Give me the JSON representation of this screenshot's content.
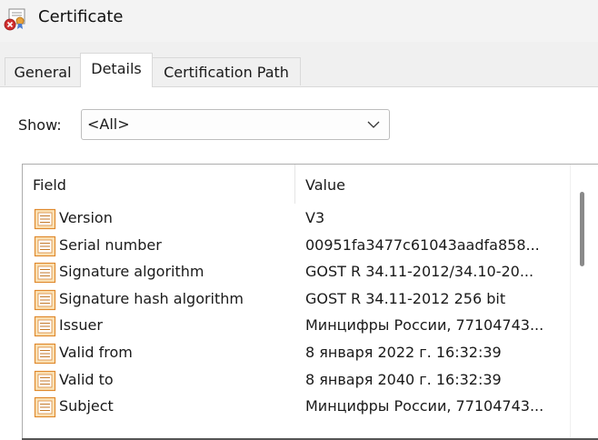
{
  "window": {
    "title": "Certificate",
    "title_icon": "certificate-error-icon"
  },
  "tabs": [
    {
      "label": "General",
      "selected": false
    },
    {
      "label": "Details",
      "selected": true
    },
    {
      "label": "Certification Path",
      "selected": false
    }
  ],
  "show": {
    "label": "Show:",
    "selected": "<All>"
  },
  "list": {
    "headers": {
      "field": "Field",
      "value": "Value"
    },
    "rows": [
      {
        "field": "Version",
        "value": "V3"
      },
      {
        "field": "Serial number",
        "value": "00951fa3477c61043aadfa858..."
      },
      {
        "field": "Signature algorithm",
        "value": "GOST R 34.11-2012/34.10-20..."
      },
      {
        "field": "Signature hash algorithm",
        "value": "GOST R 34.11-2012 256 bit"
      },
      {
        "field": "Issuer",
        "value": "Минцифры России, 77104743..."
      },
      {
        "field": "Valid from",
        "value": "8 января 2022 г. 16:32:39"
      },
      {
        "field": "Valid to",
        "value": "8 января 2040 г. 16:32:39"
      },
      {
        "field": "Subject",
        "value": "Минцифры России, 77104743..."
      }
    ],
    "row_icon": "certificate-field-icon"
  },
  "colors": {
    "icon_orange": "#e08a2e",
    "icon_fill": "#fbe3b8"
  }
}
